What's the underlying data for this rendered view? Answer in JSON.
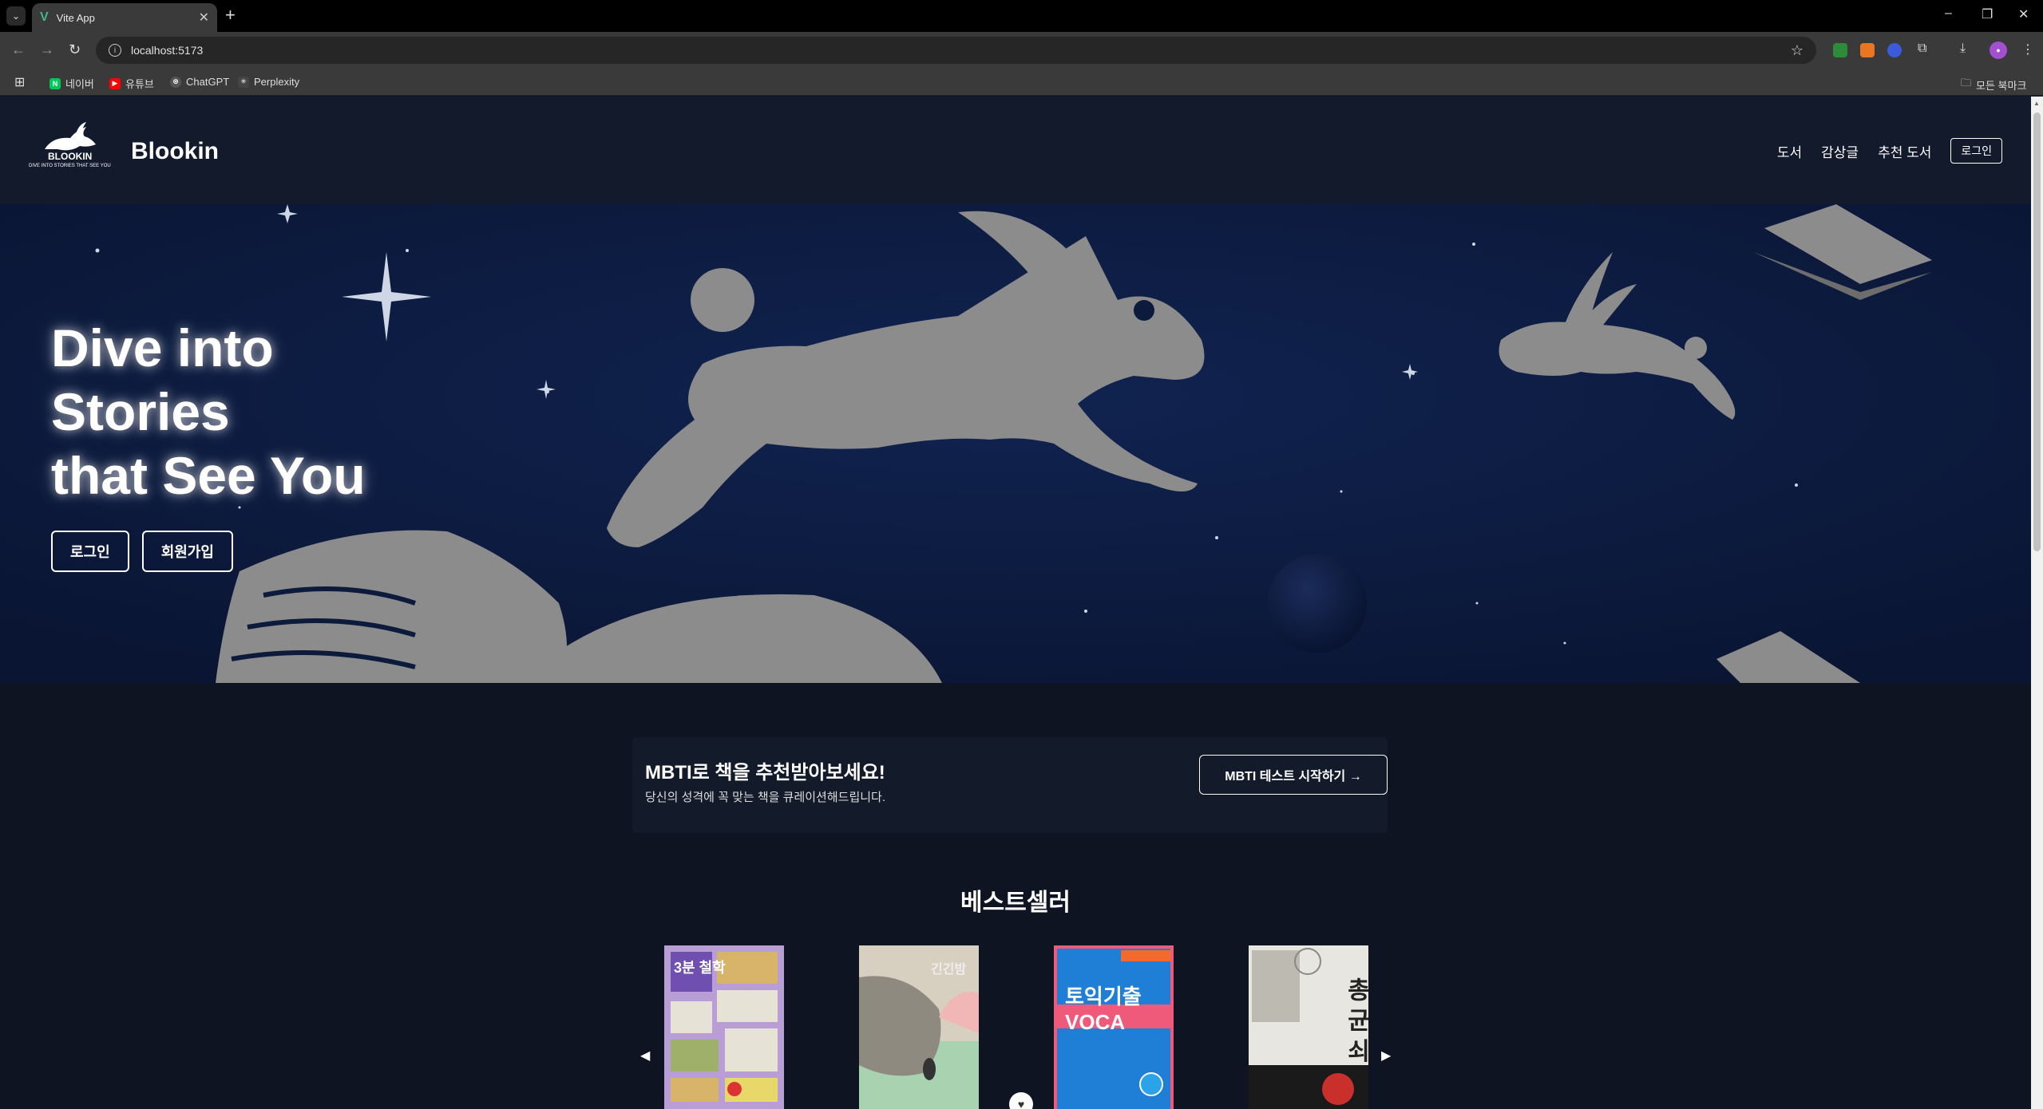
{
  "browser": {
    "tab_title": "Vite App",
    "url": "localhost:5173",
    "bookmarks": [
      "네이버",
      "유튜브",
      "ChatGPT",
      "Perplexity"
    ],
    "all_bookmarks": "모든 북마크"
  },
  "header": {
    "brand": "Blookin",
    "logo_word": "BLOOKIN",
    "logo_tagline": "DIVE INTO STORIES THAT SEE YOU",
    "nav": [
      "도서",
      "감상글",
      "추천 도서"
    ],
    "login": "로그인"
  },
  "hero": {
    "title_lines": [
      "Dive into",
      "Stories",
      "that See You"
    ],
    "login_button": "로그인",
    "signup_button": "회원가입"
  },
  "mbti": {
    "title": "MBTI로 책을 추천받아보세요!",
    "subtitle": "당신의 성격에 꼭 맞는 책을 큐레이션해드립니다.",
    "button": "MBTI 테스트 시작하기 →"
  },
  "bestseller": {
    "title": "베스트셀러",
    "books": [
      {
        "cover_text": "3분 철학",
        "cover_color": "#b89ed4"
      },
      {
        "cover_text": "긴긴밤",
        "cover_color": "#c9d6b8"
      },
      {
        "cover_text": "토익기출 VOCA",
        "cover_color": "#1f7fd6"
      },
      {
        "cover_text": "총 균 쇠",
        "cover_color": "#e8e6e0"
      }
    ]
  },
  "colors": {
    "page_bg": "#0f1423",
    "hero_bg": "#0c1a3b",
    "silhouette": "#8c8c8c"
  }
}
